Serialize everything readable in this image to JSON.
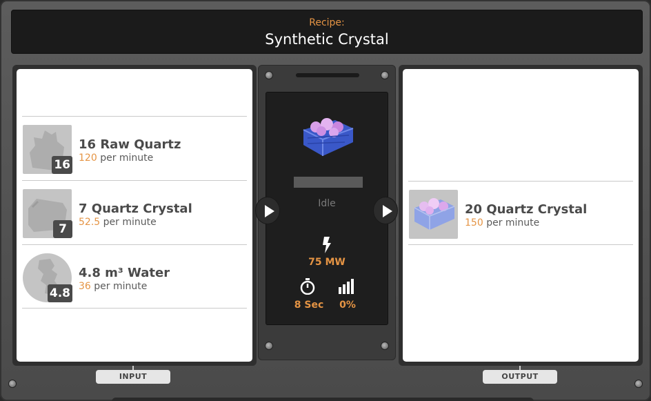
{
  "header": {
    "label": "Recipe:",
    "title": "Synthetic Crystal"
  },
  "inputs": [
    {
      "quantity": "16",
      "name": "16 Raw Quartz",
      "rate": "120",
      "rate_unit": "per minute",
      "icon": "raw-quartz-icon"
    },
    {
      "quantity": "7",
      "name": "7 Quartz Crystal",
      "rate": "52.5",
      "rate_unit": "per minute",
      "icon": "quartz-crystal-icon"
    },
    {
      "quantity": "4.8",
      "name": "4.8 m³ Water",
      "rate": "36",
      "rate_unit": "per minute",
      "icon": "water-icon"
    }
  ],
  "outputs": [
    {
      "name": "20 Quartz Crystal",
      "rate": "150",
      "rate_unit": "per minute",
      "icon": "quartz-crystal-crate-icon"
    }
  ],
  "machine": {
    "status": "Idle",
    "progress": 0,
    "power": "75 MW",
    "cycle_time": "8 Sec",
    "efficiency": "0%"
  },
  "labels": {
    "input": "INPUT",
    "output": "OUTPUT"
  },
  "colors": {
    "accent": "#e59444",
    "panel_bg": "#ffffff",
    "frame": "#4f4f4f"
  }
}
